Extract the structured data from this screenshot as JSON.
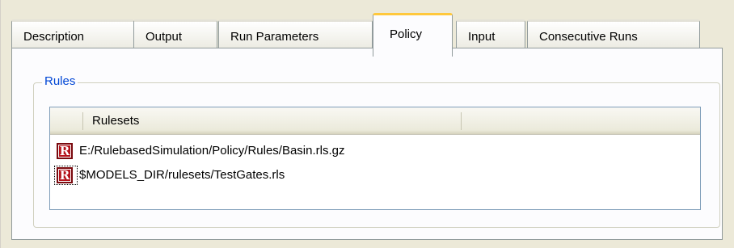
{
  "tabs": [
    {
      "label": "Description",
      "active": false
    },
    {
      "label": "Output",
      "active": false
    },
    {
      "label": "Run Parameters",
      "active": false
    },
    {
      "label": "Policy",
      "active": true
    },
    {
      "label": "Input",
      "active": false
    },
    {
      "label": "Consecutive Runs",
      "active": false
    }
  ],
  "group": {
    "title": "Rules"
  },
  "list": {
    "column_header": "Rulesets",
    "rows": [
      {
        "icon": "ruleset-r-icon",
        "icon_glyph": "R",
        "path": "E:/RulebasedSimulation/Policy/Rules/Basin.rls.gz"
      },
      {
        "icon": "ruleset-r-icon",
        "icon_glyph": "R",
        "path": "$MODELS_DIR/rulesets/TestGates.rls"
      }
    ]
  },
  "colors": {
    "active_tab_accent": "#ffc83c",
    "group_title": "#0046d5",
    "ruleset_icon": "#b4131b"
  }
}
